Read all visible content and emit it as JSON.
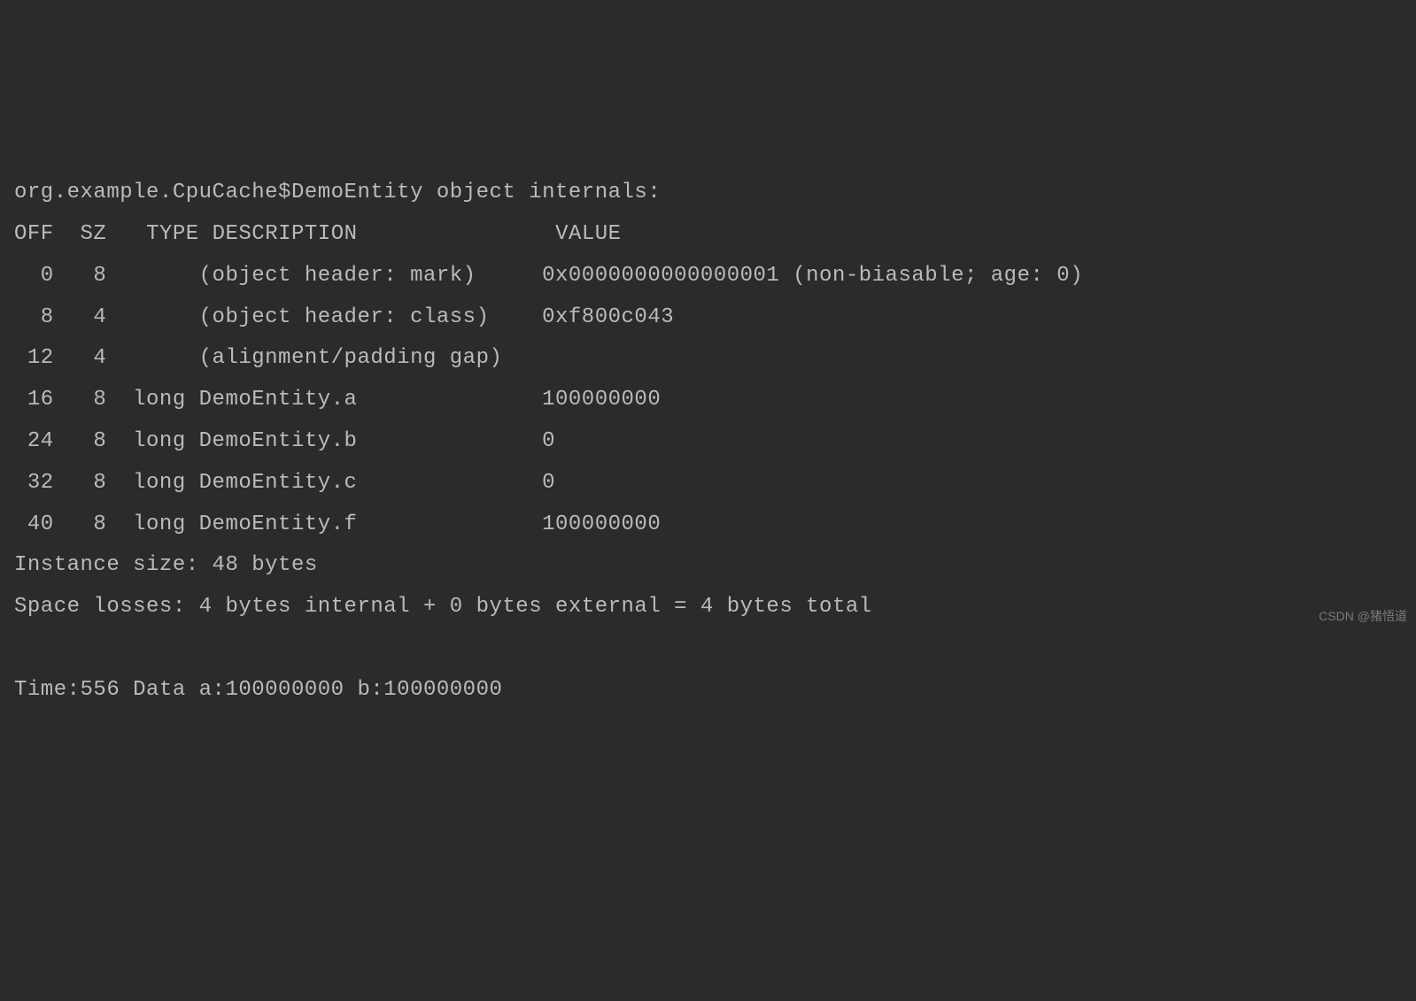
{
  "title": "org.example.CpuCache$DemoEntity object internals:",
  "headers": {
    "off": "OFF",
    "sz": "SZ",
    "type": "TYPE",
    "description": "DESCRIPTION",
    "value": "VALUE"
  },
  "rows": [
    {
      "off": "0",
      "sz": "8",
      "type": "",
      "description": "(object header: mark)",
      "value": "0x0000000000000001 (non-biasable; age: 0)"
    },
    {
      "off": "8",
      "sz": "4",
      "type": "",
      "description": "(object header: class)",
      "value": "0xf800c043"
    },
    {
      "off": "12",
      "sz": "4",
      "type": "",
      "description": "(alignment/padding gap)",
      "value": ""
    },
    {
      "off": "16",
      "sz": "8",
      "type": "long",
      "description": "DemoEntity.a",
      "value": "100000000"
    },
    {
      "off": "24",
      "sz": "8",
      "type": "long",
      "description": "DemoEntity.b",
      "value": "0"
    },
    {
      "off": "32",
      "sz": "8",
      "type": "long",
      "description": "DemoEntity.c",
      "value": "0"
    },
    {
      "off": "40",
      "sz": "8",
      "type": "long",
      "description": "DemoEntity.f",
      "value": "100000000"
    }
  ],
  "instance_size": "Instance size: 48 bytes",
  "space_losses": "Space losses: 4 bytes internal + 0 bytes external = 4 bytes total",
  "time_line": "Time:556 Data a:100000000 b:100000000",
  "watermark": "CSDN @猪悟道"
}
